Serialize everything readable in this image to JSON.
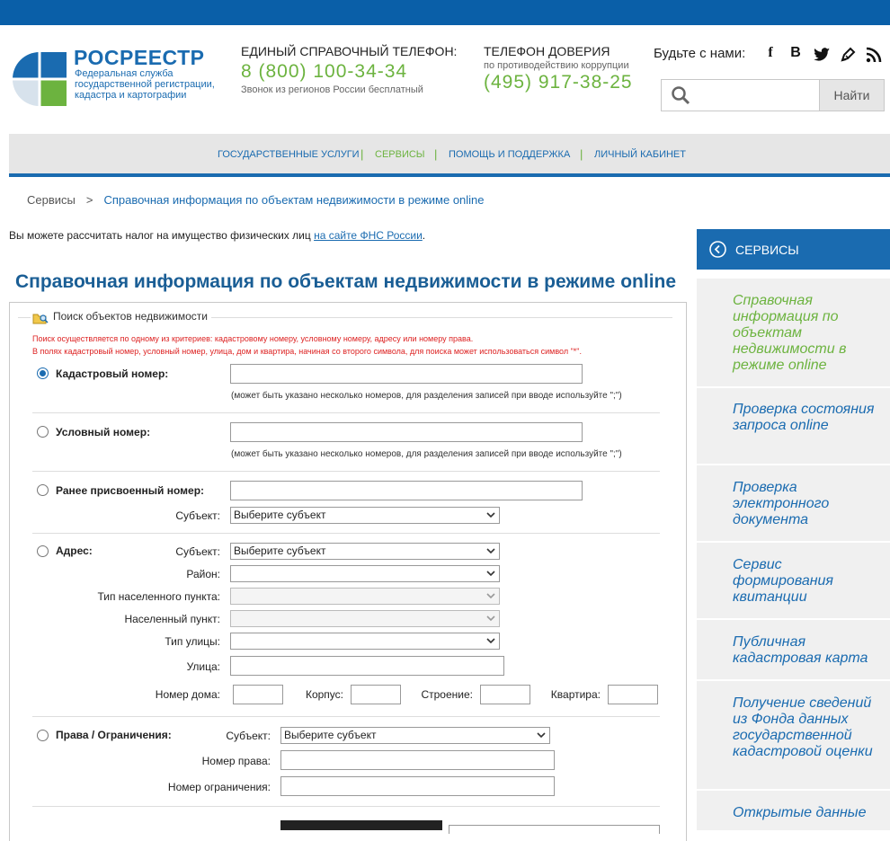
{
  "header": {
    "logo_title": "РОСРЕЕСТР",
    "logo_subtitle": "Федеральная служба государственной регистрации, кадастра и картографии",
    "phone_label": "ЕДИНЫЙ СПРАВОЧНЫЙ ТЕЛЕФОН:",
    "phone_number": "8 (800) 100-34-34",
    "phone_note": "Звонок из регионов России бесплатный",
    "trust_label": "ТЕЛЕФОН ДОВЕРИЯ",
    "trust_sub": "по противодействию коррупции",
    "trust_number": "(495) 917-38-25",
    "social_label": "Будьте с нами:",
    "social_icons": [
      "facebook-icon",
      "vk-icon",
      "twitter-icon",
      "blog-icon",
      "rss-icon"
    ],
    "search_placeholder": "",
    "search_button": "Найти"
  },
  "nav": {
    "items": [
      "ГОСУДАРСТВЕННЫЕ УСЛУГИ",
      "СЕРВИСЫ",
      "ПОМОЩЬ И ПОДДЕРЖКА",
      "ЛИЧНЫЙ КАБИНЕТ"
    ],
    "separator": "|"
  },
  "breadcrumb": {
    "root": "Сервисы",
    "separator": ">",
    "current": "Справочная информация по объектам недвижимости в режиме online"
  },
  "tax_note": {
    "text": "Вы можете рассчитать налог на имущество физических лиц ",
    "link": "на сайте ФНС России",
    "end": "."
  },
  "page_title": "Справочная информация по объектам недвижимости в режиме online",
  "form": {
    "legend": "Поиск объектов недвижимости",
    "hint1": "Поиск осуществляется по одному из критериев: кадастровому номеру, условному номеру, адресу или номеру права.",
    "hint2": "В полях кадастровый номер, условный номер, улица, дом и квартира, начиная со второго символа, для поиска может использоваться символ \"*\".",
    "multi_note": "(может быть указано несколько номеров, для разделения записей при вводе используйте \";\")",
    "cadastral_label": "Кадастровый номер:",
    "conditional_label": "Условный номер:",
    "previous_label": "Ранее присвоенный номер:",
    "address_label": "Адрес:",
    "rights_label": "Права / Ограничения:",
    "subject_label": "Субъект:",
    "district_label": "Район:",
    "locality_type_label": "Тип населенного пункта:",
    "locality_label": "Населенный пункт:",
    "street_type_label": "Тип улицы:",
    "street_label": "Улица:",
    "house_label": "Номер дома:",
    "building_label": "Корпус:",
    "structure_label": "Строение:",
    "flat_label": "Квартира:",
    "right_number_label": "Номер права:",
    "restriction_number_label": "Номер ограничения:",
    "subject_placeholder": "Выберите субъект"
  },
  "sidebar": {
    "title": "СЕРВИСЫ",
    "items": [
      "Справочная информация по объектам недвижимости в режиме online",
      "Проверка состояния запроса online",
      "Проверка электронного документа",
      "Сервис формирования квитанции",
      "Публичная кадастровая карта",
      "Получение сведений из Фонда данных государственной кадастровой оценки",
      "Открытые данные"
    ]
  },
  "colors": {
    "brand_blue": "#1a6bb0",
    "accent_green": "#6cb33f",
    "hint_red": "#d22222"
  }
}
